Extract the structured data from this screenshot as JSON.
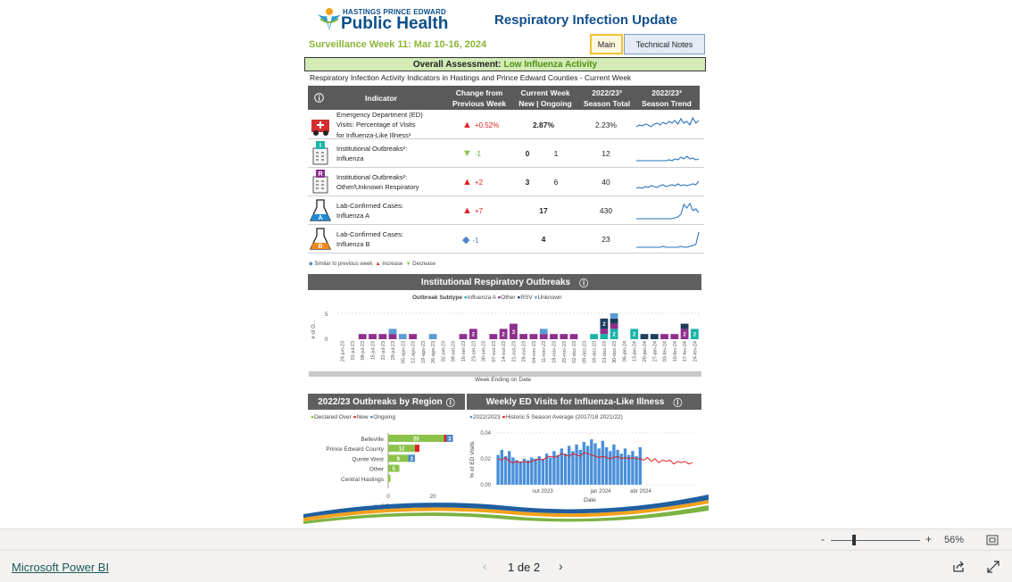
{
  "report": {
    "logo_line1": "HASTINGS PRINCE EDWARD",
    "logo_line2": "Public Health",
    "title": "Respiratory Infection Update",
    "surveillance_week": "Surveillance Week 11: Mar 10-16, 2024",
    "nav_main": "Main",
    "nav_technical": "Technical Notes",
    "overall_label": "Overall Assessment:",
    "overall_level": "Low Influenza Activity",
    "table_subtitle": "Respiratory Infection Activity Indicators in Hastings and Prince Edward Counties - Current Week"
  },
  "table": {
    "headers": {
      "indicator": "Indicator",
      "change_1": "Change from",
      "change_2": "Previous Week",
      "current_1": "Current Week",
      "current_2": "New | Ongoing",
      "season_1": "2022/23³",
      "season_2": "Season Total",
      "trend_1": "2022/23³",
      "trend_2": "Season Trend"
    },
    "rows": [
      {
        "line1": "Emergency Department (ED)",
        "line2": "Visits: Percentage of Visits",
        "line3": "for Influenza-Like Illness¹",
        "change": "+0.52%",
        "direction": "increase",
        "new": "2.87%",
        "ongoing": "",
        "total": "2.23%",
        "icon": "ambulance-icon",
        "trend": [
          0.4,
          0.5,
          0.45,
          0.55,
          0.5,
          0.4,
          0.55,
          0.6,
          0.5,
          0.65,
          0.55,
          0.7,
          0.6,
          0.75,
          0.55,
          0.85,
          0.6,
          0.7,
          0.5,
          0.9,
          0.6,
          0.75
        ]
      },
      {
        "line1": "Institutional Outbreaks²:",
        "line2": "Influenza",
        "line3": "",
        "change": "-1",
        "direction": "decrease",
        "new": "0",
        "ongoing": "1",
        "total": "12",
        "icon": "building-i-icon",
        "trend": [
          0.1,
          0.1,
          0.1,
          0.1,
          0.1,
          0.1,
          0.1,
          0.1,
          0.1,
          0.1,
          0.1,
          0.15,
          0.1,
          0.2,
          0.15,
          0.3,
          0.2,
          0.35,
          0.2,
          0.25,
          0.15,
          0.2
        ]
      },
      {
        "line1": "Institutional Outbreaks²:",
        "line2": "Other/Unknown Respiratory",
        "line3": "",
        "change": "+2",
        "direction": "increase",
        "new": "3",
        "ongoing": "6",
        "total": "40",
        "icon": "building-r-icon",
        "trend": [
          0.15,
          0.2,
          0.15,
          0.25,
          0.2,
          0.3,
          0.25,
          0.2,
          0.3,
          0.35,
          0.25,
          0.3,
          0.35,
          0.3,
          0.4,
          0.3,
          0.35,
          0.3,
          0.35,
          0.4,
          0.35,
          0.55
        ]
      },
      {
        "line1": "Lab-Confirmed Cases:",
        "line2": "Influenza A",
        "line3": "",
        "change": "+7",
        "direction": "increase",
        "new": "17",
        "ongoing": "",
        "total": "430",
        "icon": "flask-a-icon",
        "trend": [
          0.05,
          0.05,
          0.05,
          0.05,
          0.05,
          0.05,
          0.05,
          0.05,
          0.05,
          0.05,
          0.05,
          0.05,
          0.05,
          0.1,
          0.15,
          0.3,
          0.85,
          0.65,
          0.9,
          0.5,
          0.6,
          0.4
        ]
      },
      {
        "line1": "Lab-Confirmed Cases:",
        "line2": "Influenza B",
        "line3": "",
        "change": "-1",
        "direction": "similar",
        "new": "4",
        "ongoing": "",
        "total": "23",
        "icon": "flask-b-icon",
        "trend": [
          0.05,
          0.05,
          0.05,
          0.05,
          0.05,
          0.05,
          0.05,
          0.05,
          0.05,
          0.1,
          0.05,
          0.05,
          0.05,
          0.05,
          0.05,
          0.1,
          0.05,
          0.05,
          0.1,
          0.15,
          0.2,
          0.9
        ]
      }
    ],
    "legend": {
      "similar": "Similar to previous week",
      "increase": "Increase",
      "decrease": "Decrease"
    }
  },
  "colors": {
    "increase": "#e02020",
    "decrease": "#8bc34a",
    "similar": "#4a86c8",
    "trend": "#2a74b8",
    "influenza_a": "#19b5a8",
    "other": "#8e2f8e",
    "rsv": "#1b3e5c",
    "unknown": "#5b9bd5",
    "declared_over": "#8bc34a",
    "new": "#e02020",
    "ongoing": "#4a86c8",
    "ed_bar": "#4a90d9",
    "historic": "#e02020"
  },
  "outbreaks": {
    "section_title": "Institutional Respiratory Outbreaks",
    "legend_title": "Outbreak Subtype",
    "legend_items": [
      "Influenza A",
      "Other",
      "RSV",
      "Unknown"
    ],
    "y_axis_label": "# of O...",
    "y_tick_5": "5",
    "y_tick_0": "0",
    "x_axis_label": "Week Ending on Date"
  },
  "chart_data": [
    {
      "type": "bar",
      "stacked": true,
      "categories": [
        "24-jun-23",
        "01-jul-23",
        "08-jul-23",
        "15-jul-23",
        "22-jul-23",
        "29-jul-23",
        "05-ago-23",
        "12-ago-23",
        "19-ago-23",
        "26-ago-23",
        "02-set-23",
        "09-set-23",
        "16-set-23",
        "23-set-23",
        "30-set-23",
        "07-out-23",
        "14-out-23",
        "21-out-23",
        "28-out-23",
        "04-nov-23",
        "11-nov-23",
        "18-nov-23",
        "25-nov-23",
        "02-dez-23",
        "09-dez-23",
        "16-dez-23",
        "23-dez-23",
        "30-dez-23",
        "06-jan-24",
        "13-jan-24",
        "20-jan-24",
        "27-jan-24",
        "03-fev-24",
        "10-fev-24",
        "17-fev-24",
        "24-fev-24"
      ],
      "series": [
        {
          "name": "Influenza A",
          "values": [
            0,
            0,
            0,
            0,
            0,
            0,
            0,
            0,
            0,
            0,
            0,
            0,
            0,
            0,
            0,
            0,
            0,
            0,
            0,
            0,
            0,
            0,
            0,
            0,
            0,
            1,
            1,
            2,
            0,
            2,
            0,
            0,
            0,
            0,
            0,
            2
          ]
        },
        {
          "name": "Other",
          "values": [
            0,
            0,
            1,
            1,
            1,
            1,
            0,
            1,
            0,
            0,
            0,
            0,
            1,
            2,
            0,
            1,
            2,
            3,
            1,
            1,
            1,
            1,
            1,
            1,
            0,
            0,
            1,
            1,
            0,
            0,
            0,
            0,
            1,
            1,
            2,
            0
          ]
        },
        {
          "name": "RSV",
          "values": [
            0,
            0,
            0,
            0,
            0,
            0,
            0,
            0,
            0,
            0,
            0,
            0,
            0,
            0,
            0,
            0,
            0,
            0,
            0,
            0,
            0,
            0,
            0,
            0,
            0,
            0,
            2,
            1,
            0,
            0,
            1,
            1,
            0,
            0,
            1,
            0
          ]
        },
        {
          "name": "Unknown",
          "values": [
            0,
            0,
            0,
            0,
            0,
            1,
            1,
            0,
            0,
            1,
            0,
            0,
            0,
            0,
            0,
            0,
            0,
            0,
            0,
            0,
            1,
            0,
            0,
            0,
            0,
            0,
            0,
            1,
            0,
            0,
            0,
            0,
            0,
            0,
            0,
            0
          ]
        }
      ],
      "ylabel": "# of O...",
      "xlabel": "Week Ending on Date",
      "ylim": [
        0,
        5
      ]
    },
    {
      "type": "bar",
      "stacked": true,
      "orientation": "horizontal",
      "title": "2022/23 Outbreaks by Region",
      "categories": [
        "Belleville",
        "Prince Edward County",
        "Quinte West",
        "Other",
        "Central Hastings"
      ],
      "series": [
        {
          "name": "Declared Over",
          "values": [
            25,
            12,
            9,
            5,
            1
          ]
        },
        {
          "name": "New",
          "values": [
            1,
            2,
            0,
            0,
            0
          ]
        },
        {
          "name": "Ongoing",
          "values": [
            3,
            0,
            3,
            0,
            0
          ]
        }
      ],
      "xlabel": "# of Outbreaks",
      "xlim": [
        0,
        20
      ]
    },
    {
      "type": "line",
      "title": "Weekly ED Visits for Influenza-Like Illness",
      "bars_series": {
        "name": "2022/2023",
        "values": [
          0.023,
          0.027,
          0.022,
          0.026,
          0.021,
          0.019,
          0.018,
          0.02,
          0.019,
          0.021,
          0.02,
          0.022,
          0.02,
          0.024,
          0.021,
          0.026,
          0.023,
          0.028,
          0.024,
          0.03,
          0.026,
          0.031,
          0.027,
          0.033,
          0.03,
          0.035,
          0.032,
          0.028,
          0.034,
          0.029,
          0.026,
          0.031,
          0.027,
          0.024,
          0.028,
          0.023,
          0.026,
          0.022,
          0.029
        ]
      },
      "line_series": {
        "name": "Historic 5 Season Average (2017/18  2021/22)",
        "values": [
          0.02,
          0.019,
          0.021,
          0.018,
          0.017,
          0.018,
          0.017,
          0.018,
          0.017,
          0.018,
          0.019,
          0.02,
          0.019,
          0.021,
          0.022,
          0.021,
          0.022,
          0.024,
          0.023,
          0.022,
          0.024,
          0.023,
          0.022,
          0.025,
          0.024,
          0.023,
          0.022,
          0.021,
          0.022,
          0.021,
          0.02,
          0.021,
          0.022,
          0.02,
          0.021,
          0.02,
          0.021,
          0.02,
          0.02,
          0.019,
          0.021,
          0.018,
          0.02,
          0.017,
          0.019,
          0.018,
          0.019,
          0.016,
          0.018,
          0.017,
          0.018,
          0.016,
          0.017
        ]
      },
      "x_ticks": [
        "out 2023",
        "jan 2024",
        "abr 2024"
      ],
      "y_ticks": [
        "0,04",
        "0,02",
        "0,00"
      ],
      "xlabel": "Date",
      "ylabel": "% of ED Visits"
    }
  ],
  "region": {
    "section_title": "2022/23 Outbreaks by Region",
    "legend_items": [
      "Declared Over",
      "New",
      "Ongoing"
    ],
    "x_tick_0": "0",
    "x_tick_20": "20",
    "xlabel": "# of Outbreaks"
  },
  "ed": {
    "section_title": "Weekly ED Visits for Influenza-Like Illness",
    "legend_bars": "2022/2023",
    "legend_line": "Historic 5 Season Average (2017/18  2021/22)",
    "ylabel": "% of ED Visits",
    "xlabel": "Date"
  },
  "zoom": {
    "minus": "-",
    "plus": "+",
    "level": "56%"
  },
  "footer": {
    "brand": "Microsoft Power BI",
    "page": "1 de 2"
  }
}
